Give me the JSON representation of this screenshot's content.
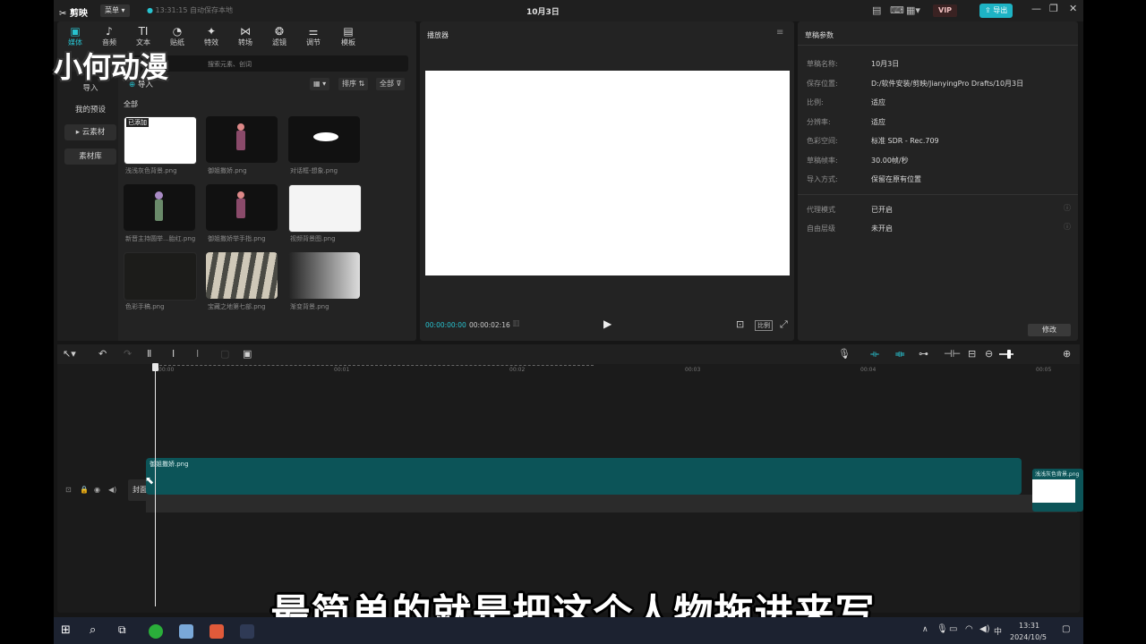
{
  "app": {
    "name": "剪映",
    "menu_label": "菜单",
    "autosave": "13:31:15 自动保存本地",
    "project_title": "10月3日",
    "vip": "VIP",
    "export_label": "导出"
  },
  "media_tabs": [
    {
      "label": "媒体",
      "icon": "media-icon",
      "glyph": "▣"
    },
    {
      "label": "音频",
      "icon": "audio-icon",
      "glyph": "♪"
    },
    {
      "label": "文本",
      "icon": "text-icon",
      "glyph": "TI"
    },
    {
      "label": "贴纸",
      "icon": "sticker-icon",
      "glyph": "◔"
    },
    {
      "label": "特效",
      "icon": "effects-icon",
      "glyph": "✦"
    },
    {
      "label": "转场",
      "icon": "transition-icon",
      "glyph": "⋈"
    },
    {
      "label": "滤镜",
      "icon": "filter-icon",
      "glyph": "❂"
    },
    {
      "label": "调节",
      "icon": "adjust-icon",
      "glyph": "⚌"
    },
    {
      "label": "模板",
      "icon": "template-icon",
      "glyph": "▤"
    }
  ],
  "sidebar": [
    "导入",
    "我的预设",
    "云素材",
    "素材库"
  ],
  "media": {
    "search_placeholder": "搜索元素、创词",
    "import_label": "导入",
    "sort_label": "排序",
    "filter_label": "全部",
    "section_label": "全部",
    "added_badge": "已添加",
    "items": [
      {
        "name": "浅浅灰色背景.png"
      },
      {
        "name": "御姐撒娇.png"
      },
      {
        "name": "对话框-想象.png"
      },
      {
        "name": "新晋主持圆举...胎红.png"
      },
      {
        "name": "御姐撒娇举手指.png"
      },
      {
        "name": "视频背景图.png"
      },
      {
        "name": "色彩手稿.png"
      },
      {
        "name": "宝藏之地第七部.png"
      },
      {
        "name": "渐变背景.png"
      }
    ]
  },
  "player": {
    "title": "播放器",
    "current_time": "00:00:00:00",
    "total_time": "00:00:02:16",
    "ratio_label": "比例"
  },
  "draft": {
    "title": "草稿参数",
    "rows": [
      {
        "label": "草稿名称:",
        "value": "10月3日"
      },
      {
        "label": "保存位置:",
        "value": "D:/软件安装/剪映/JianyingPro Drafts/10月3日"
      },
      {
        "label": "比例:",
        "value": "适应"
      },
      {
        "label": "分辨率:",
        "value": "适应"
      },
      {
        "label": "色彩空间:",
        "value": "标准 SDR - Rec.709"
      },
      {
        "label": "草稿帧率:",
        "value": "30.00帧/秒"
      },
      {
        "label": "导入方式:",
        "value": "保留在原有位置"
      }
    ],
    "rows2": [
      {
        "label": "代理模式",
        "value": "已开启"
      },
      {
        "label": "自由层级",
        "value": "未开启"
      }
    ],
    "modify_label": "修改"
  },
  "timeline": {
    "ticks": [
      "00:00",
      "00:01",
      "00:02",
      "00:03",
      "00:04",
      "00:05"
    ],
    "clip_name": "御姐撒娇.png",
    "next_clip_name": "浅浅灰色背景.png",
    "cover_label": "封面"
  },
  "overlay": {
    "watermark": "小何动漫",
    "subtitle": "最简单的就是把这个人物拖进来写"
  },
  "taskbar": {
    "time": "13:31",
    "date": "2024/10/5",
    "ime": "中"
  },
  "colors": {
    "accent": "#28c2cf",
    "clip": "#0c5458",
    "background": "#161616"
  }
}
